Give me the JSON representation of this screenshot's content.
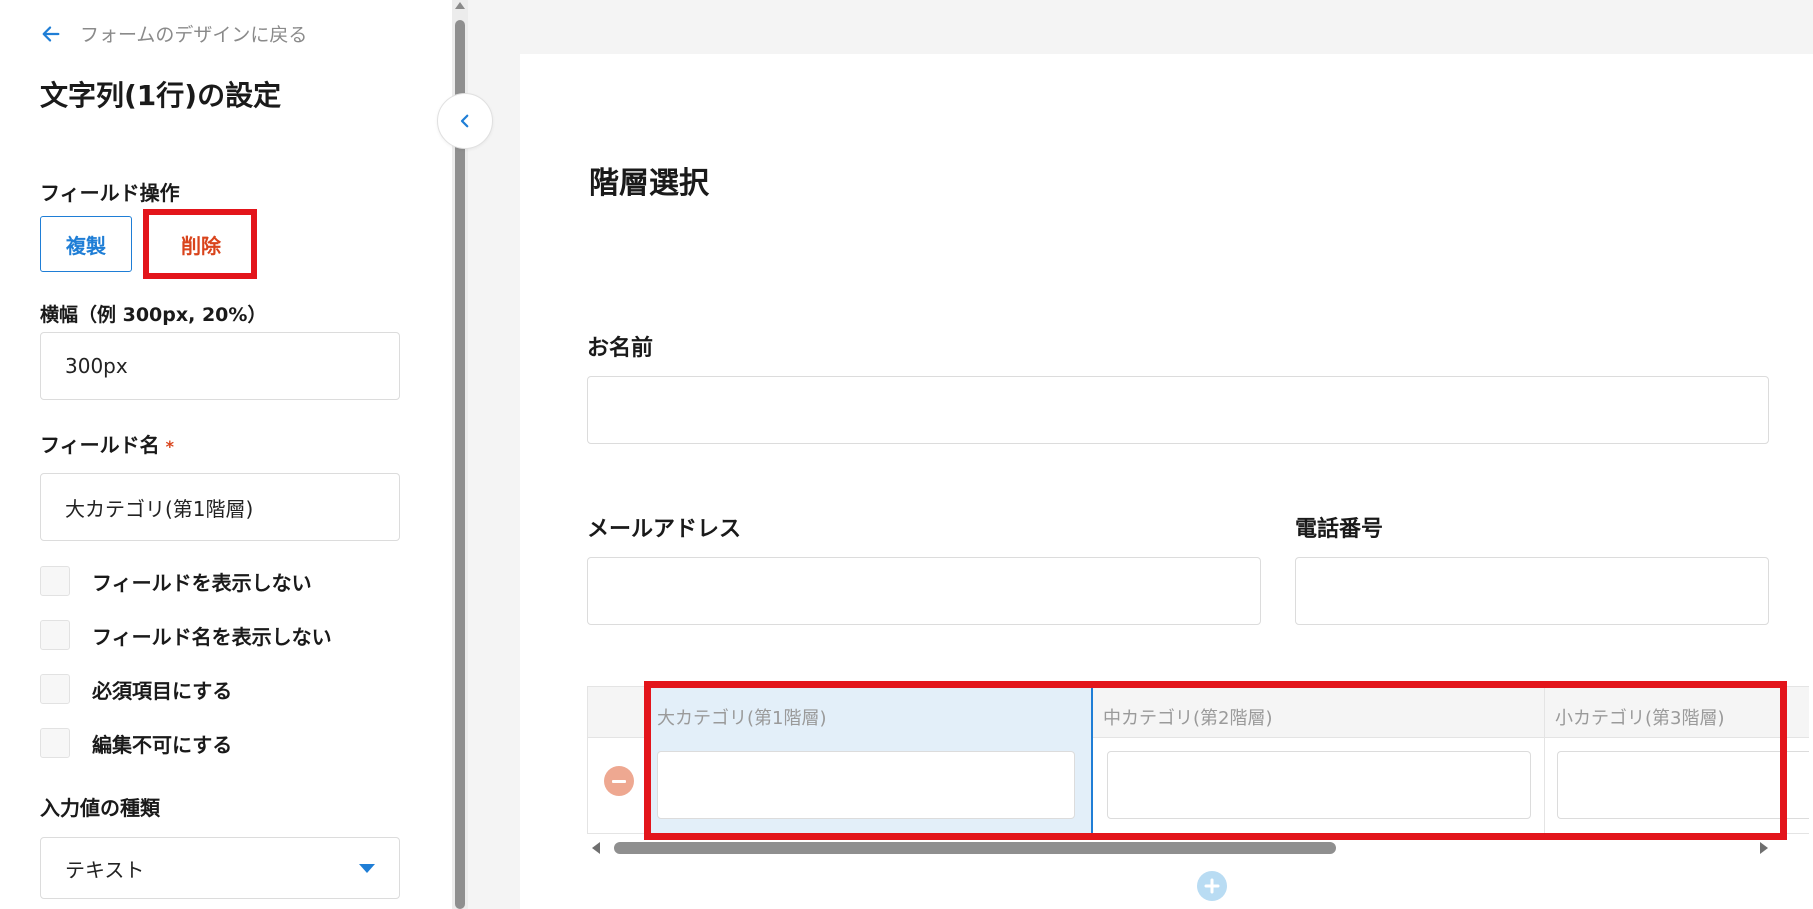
{
  "panel": {
    "back_label": "フォームのデザインに戻る",
    "title": "文字列(1行)の設定",
    "field_ops_label": "フィールド操作",
    "copy_label": "複製",
    "delete_label": "削除",
    "width_label": "横幅（例 300px, 20%）",
    "width_value": "300px",
    "field_name_label": "フィールド名",
    "required_mark": "*",
    "field_name_value": "大カテゴリ(第1階層)",
    "checkboxes": [
      {
        "label": "フィールドを表示しない"
      },
      {
        "label": "フィールド名を表示しない"
      },
      {
        "label": "必須項目にする"
      },
      {
        "label": "編集不可にする"
      }
    ],
    "input_type_label": "入力値の種類",
    "input_type_value": "テキスト"
  },
  "form": {
    "title": "階層選択",
    "name_label": "お名前",
    "email_label": "メールアドレス",
    "phone_label": "電話番号",
    "table": {
      "columns": [
        "大カテゴリ(第1階層)",
        "中カテゴリ(第2階層)",
        "小カテゴリ(第3階層)"
      ]
    }
  },
  "colors": {
    "accent": "#1f7ed6",
    "danger": "#d9441c",
    "highlight": "#e3151b",
    "selected_column": "#e3eff9"
  }
}
